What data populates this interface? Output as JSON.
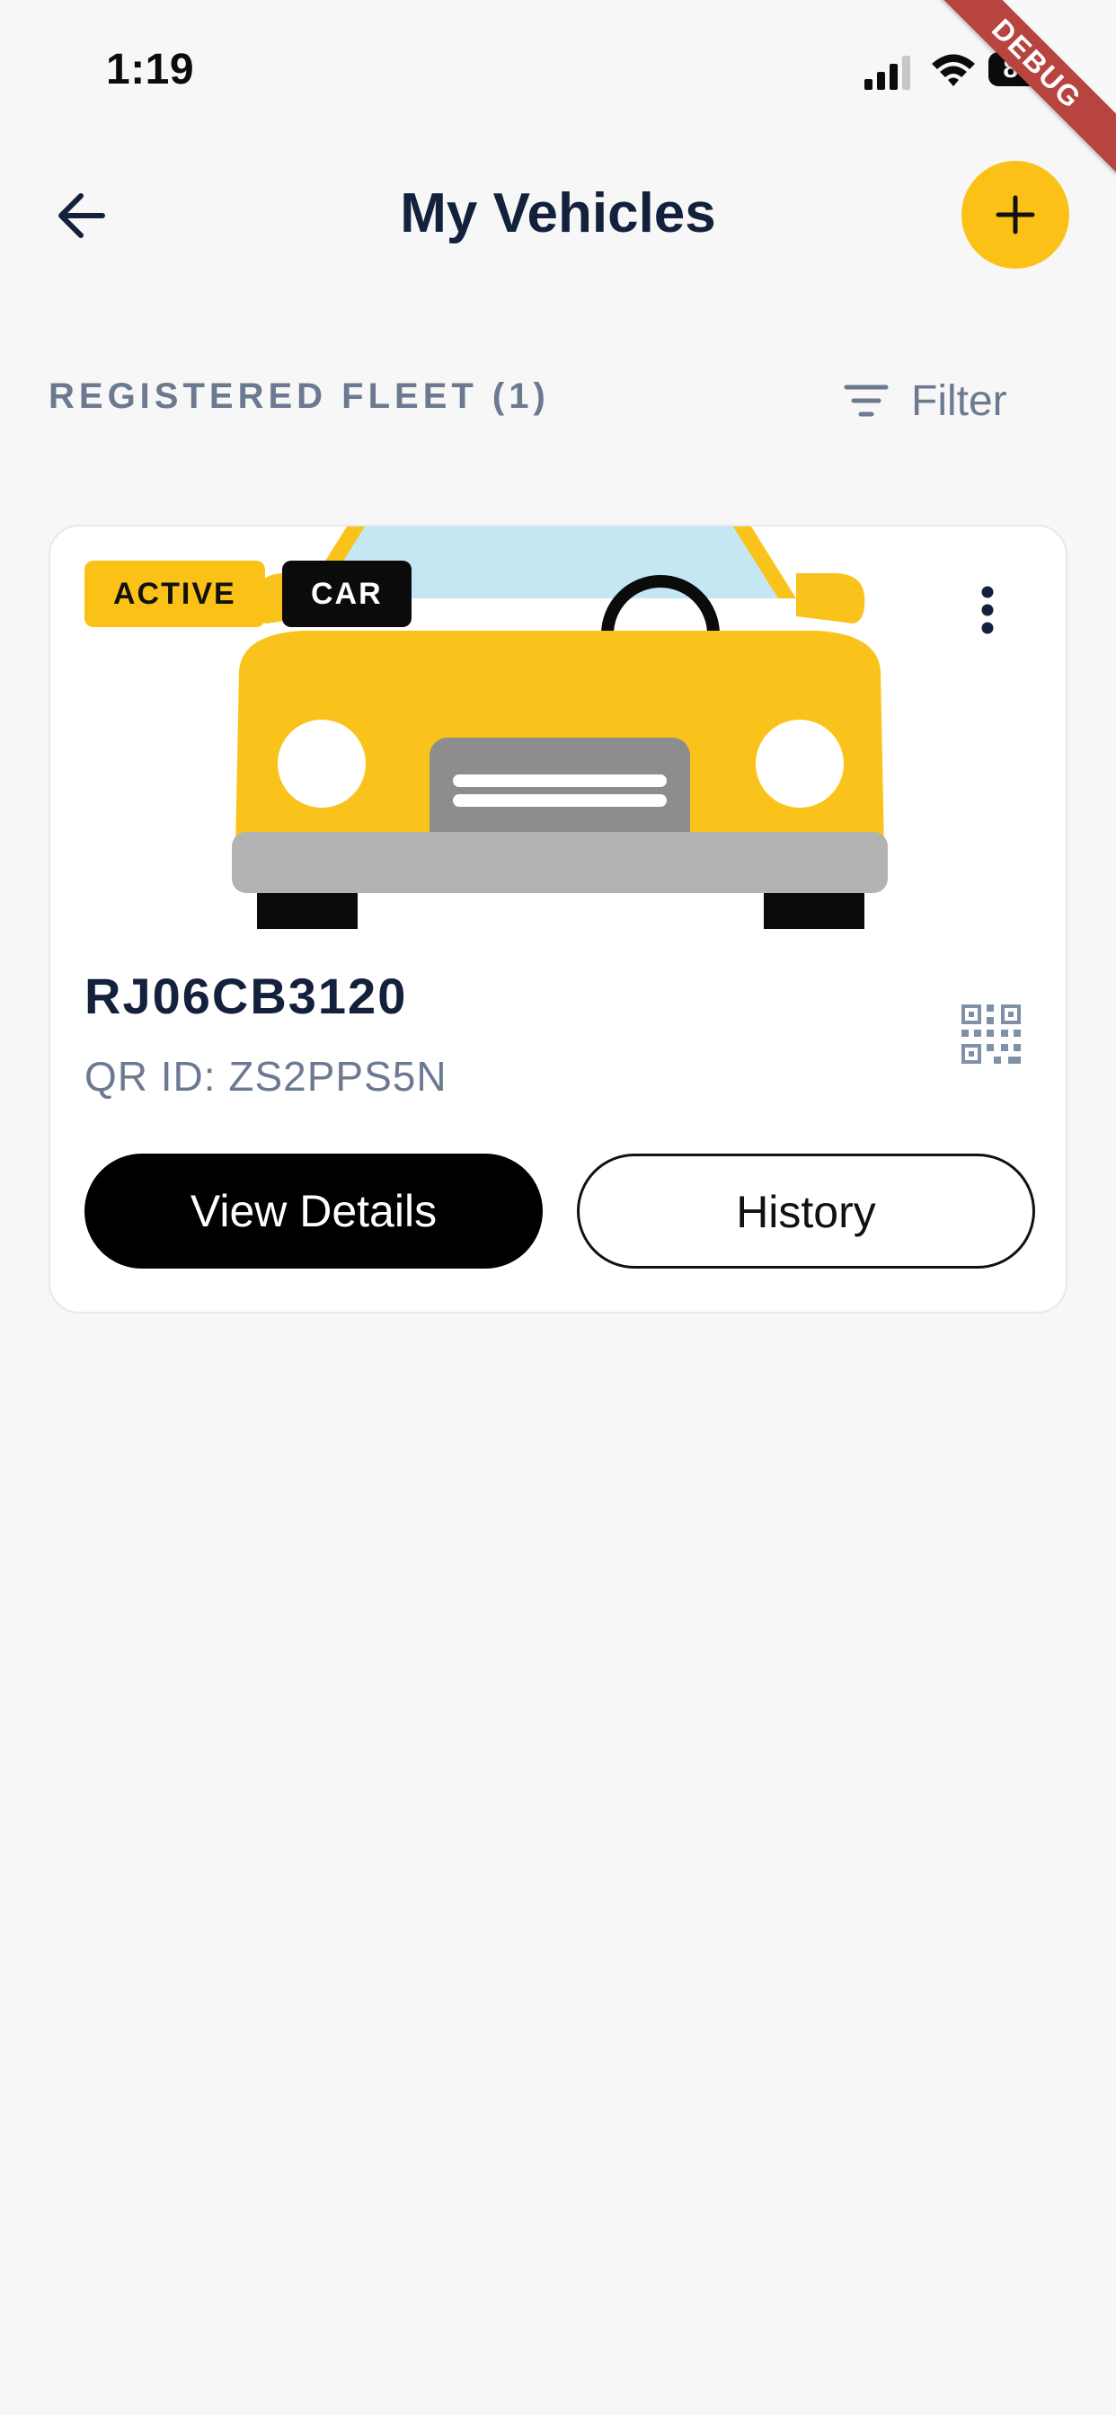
{
  "status_bar": {
    "time": "1:19",
    "battery_level": "80",
    "icons": [
      "cellular-signal-icon",
      "wifi-icon",
      "battery-icon"
    ]
  },
  "debug_banner": "DEBUG",
  "header": {
    "title": "My Vehicles",
    "back_icon": "arrow-left-icon",
    "add_icon": "plus-icon"
  },
  "section": {
    "title": "REGISTERED FLEET (1)",
    "filter_label": "Filter",
    "filter_icon": "filter-lines-icon"
  },
  "vehicles": [
    {
      "status": "ACTIVE",
      "type": "CAR",
      "plate": "RJ06CB3120",
      "qr_id": "QR ID: ZS2PPS5N",
      "image": "yellow-car-front-illustration",
      "menu_icon": "more-vertical-icon",
      "qr_icon": "qr-code-icon",
      "primary_action": "View Details",
      "secondary_action": "History"
    }
  ],
  "colors": {
    "accent": "#fbc117",
    "background": "#f7f7f7",
    "title_text": "#14213d",
    "muted_text": "#6b7a90",
    "primary_button": "#000000",
    "debug_ribbon": "#b8443f"
  }
}
